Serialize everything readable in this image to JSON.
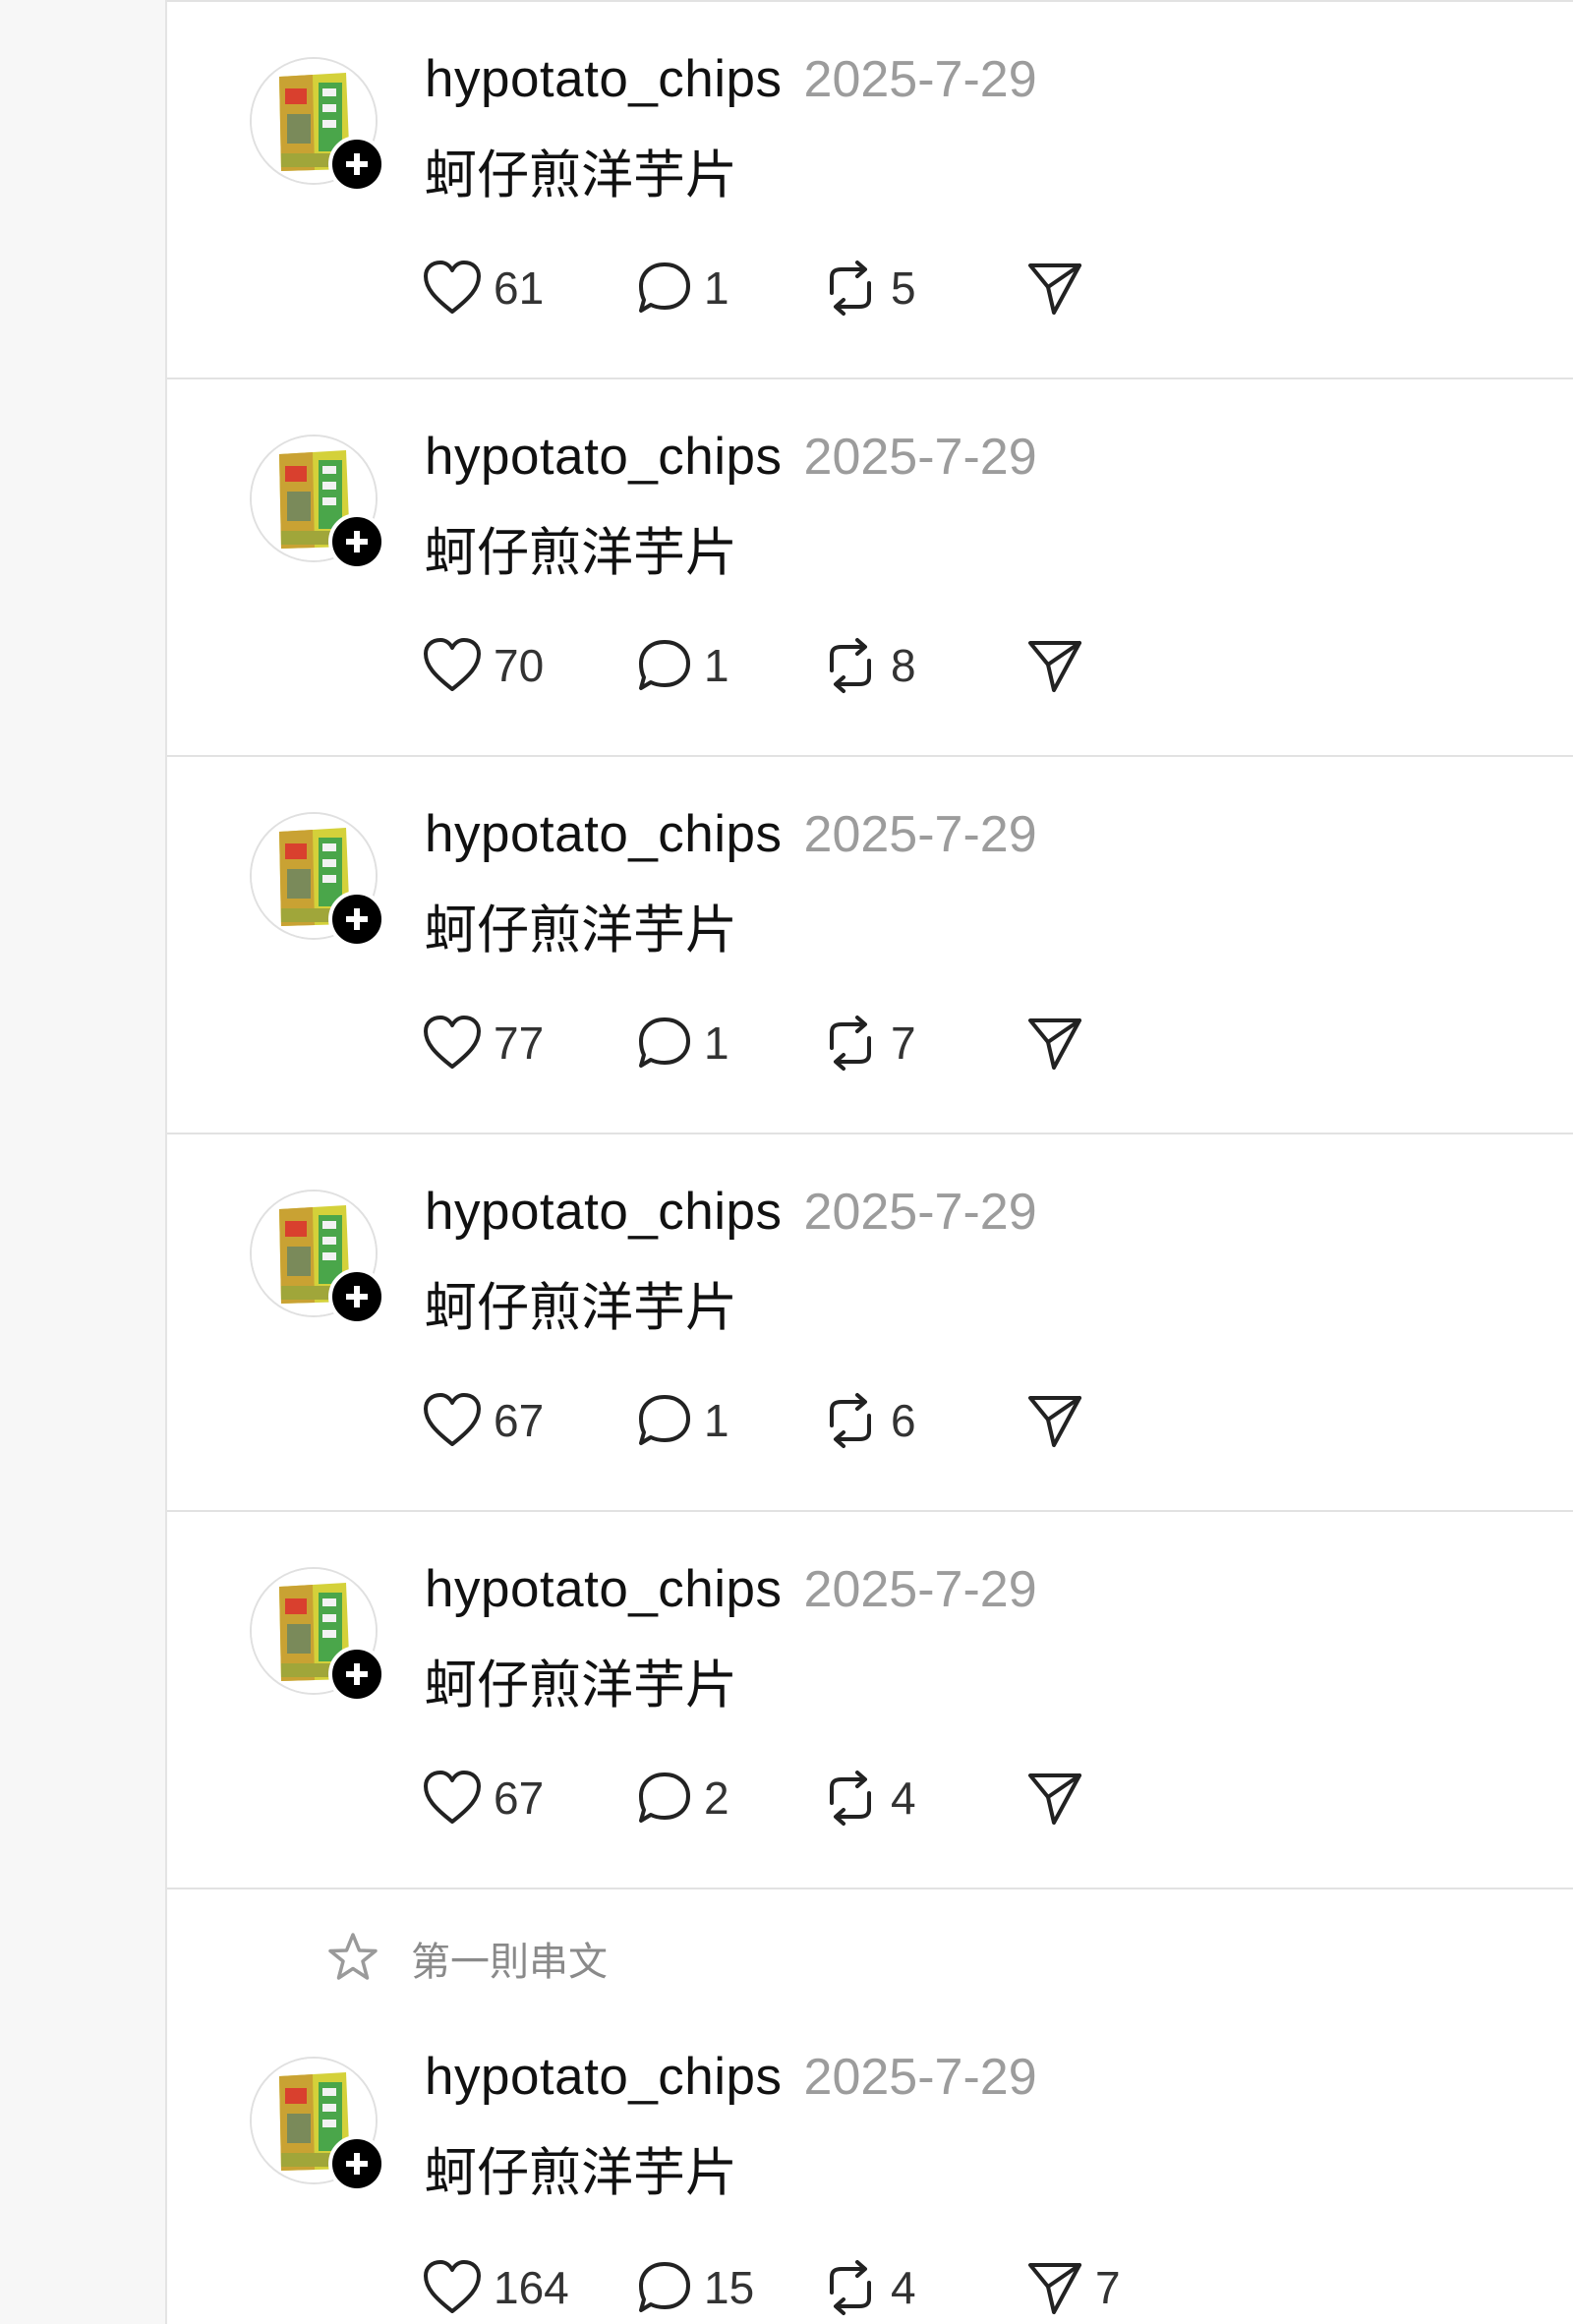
{
  "colors": {
    "text": "#111111",
    "timestamp": "#9c9c9c",
    "counts": "#333333",
    "divider": "#e2e2e2",
    "badge": "#000000"
  },
  "icons": {
    "like": "heart-icon",
    "reply": "comment-bubble-icon",
    "repost": "repost-icon",
    "share": "send-icon",
    "follow": "plus-icon",
    "pinned": "star-icon"
  },
  "posts": [
    {
      "username": "hypotato_chips",
      "date": "2025-7-29",
      "text": "蚵仔煎洋芋片",
      "likes": "61",
      "replies": "1",
      "reposts": "5",
      "shares": ""
    },
    {
      "username": "hypotato_chips",
      "date": "2025-7-29",
      "text": "蚵仔煎洋芋片",
      "likes": "70",
      "replies": "1",
      "reposts": "8",
      "shares": ""
    },
    {
      "username": "hypotato_chips",
      "date": "2025-7-29",
      "text": "蚵仔煎洋芋片",
      "likes": "77",
      "replies": "1",
      "reposts": "7",
      "shares": ""
    },
    {
      "username": "hypotato_chips",
      "date": "2025-7-29",
      "text": "蚵仔煎洋芋片",
      "likes": "67",
      "replies": "1",
      "reposts": "6",
      "shares": ""
    },
    {
      "username": "hypotato_chips",
      "date": "2025-7-29",
      "text": "蚵仔煎洋芋片",
      "likes": "67",
      "replies": "2",
      "reposts": "4",
      "shares": ""
    }
  ],
  "pinned_post": {
    "pin_label": "第一則串文",
    "username": "hypotato_chips",
    "date": "2025-7-29",
    "text": "蚵仔煎洋芋片",
    "likes": "164",
    "replies": "15",
    "reposts": "4",
    "shares": "7"
  }
}
